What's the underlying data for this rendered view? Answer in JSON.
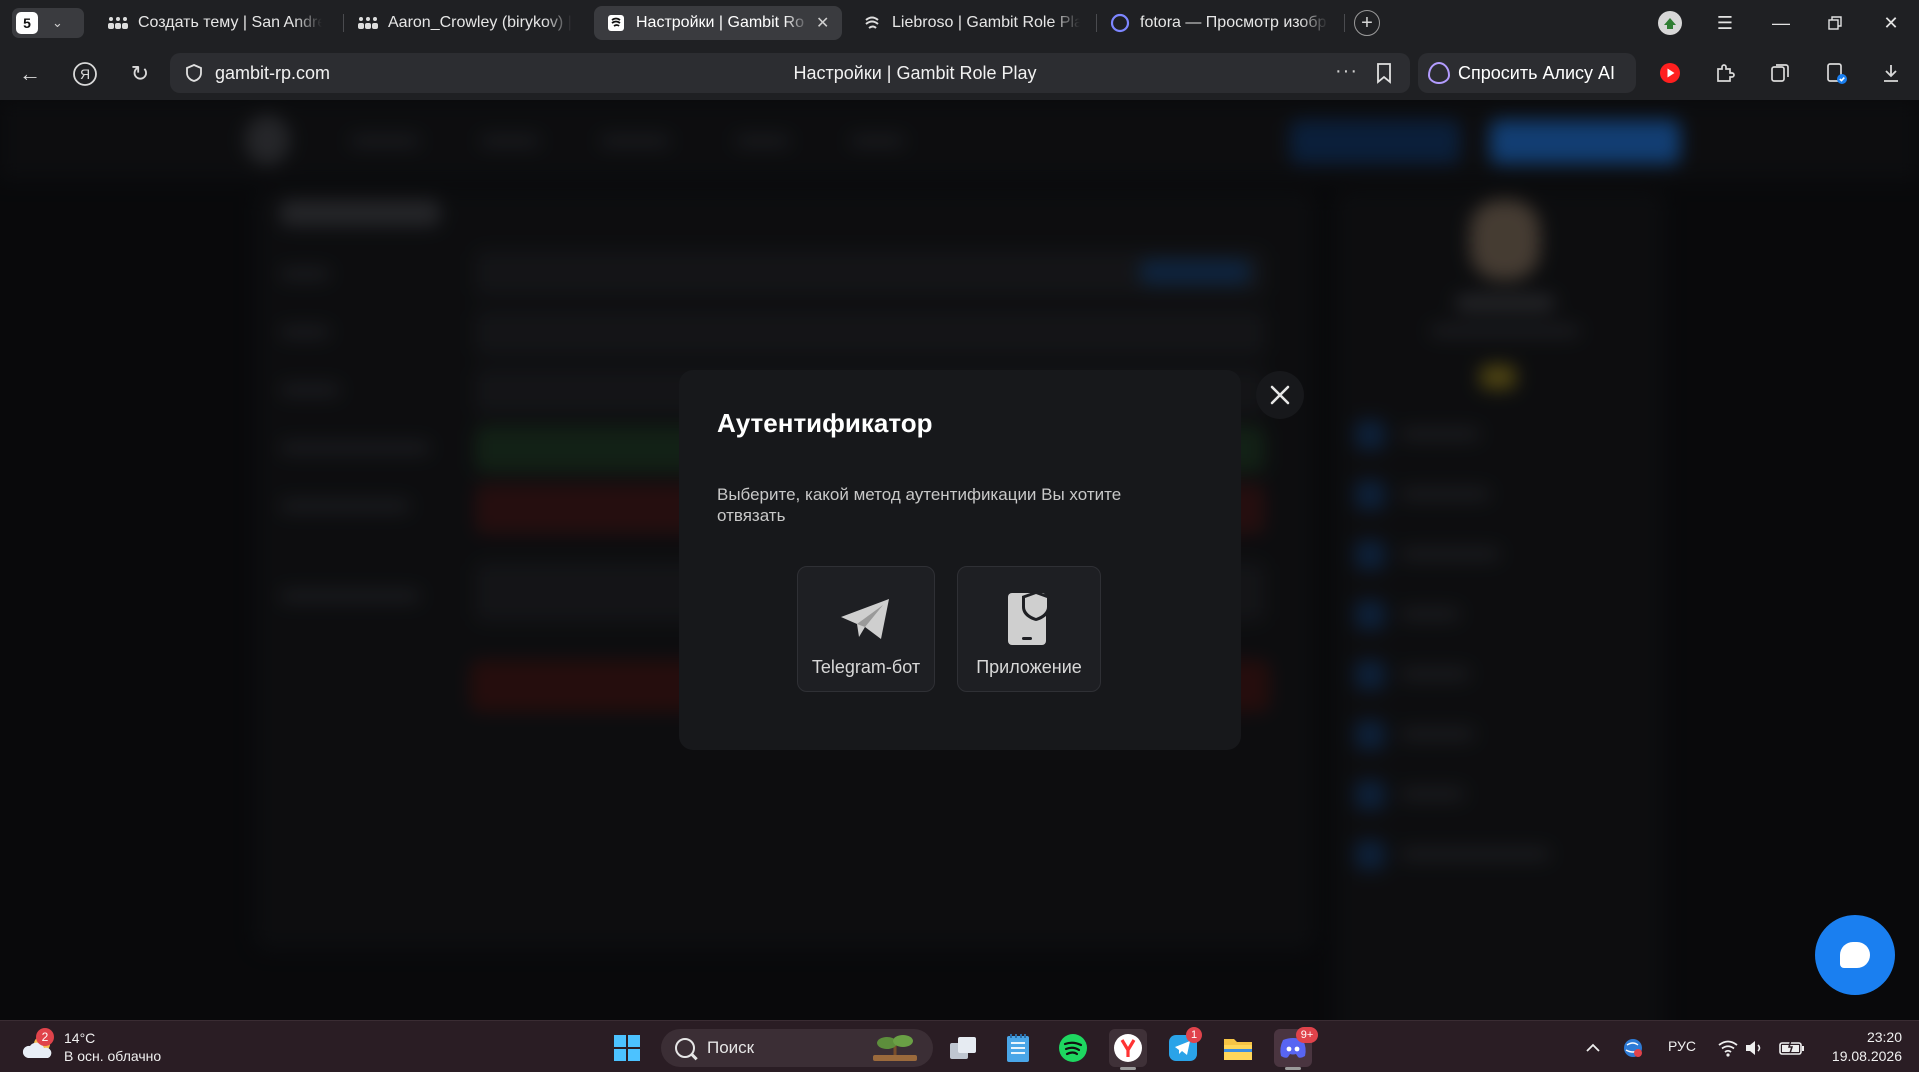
{
  "browser": {
    "tab_count": "5",
    "tabs": [
      {
        "label": "Создать тему | San Andre"
      },
      {
        "label": "Aaron_Crowley (birykov) |"
      },
      {
        "label": "Настройки | Gambit Ro"
      },
      {
        "label": "Liebroso | Gambit Role Pla"
      },
      {
        "label": "fotora — Просмотр изобр"
      }
    ],
    "url": "gambit-rp.com",
    "page_title": "Настройки | Gambit Role Play",
    "alice_button": "Спросить Алису AI"
  },
  "modal": {
    "title": "Аутентификатор",
    "description": "Выберите, какой метод аутентификации Вы хотите отвязать",
    "methods": [
      {
        "label": "Telegram-бот",
        "icon": "telegram-icon"
      },
      {
        "label": "Приложение",
        "icon": "phone-shield-icon"
      }
    ]
  },
  "taskbar": {
    "weather_temp": "14°C",
    "weather_desc": "В осн. облачно",
    "weather_badge": "2",
    "search_placeholder": "Поиск",
    "telegram_badge": "1",
    "discord_badge": "9+",
    "language": "РУС",
    "time": "23:20",
    "date": "19.08.2026"
  },
  "colors": {
    "accent_blue": "#1a7ff0",
    "modal_bg": "#17181b",
    "taskbar_bg": "#2a1d24"
  }
}
